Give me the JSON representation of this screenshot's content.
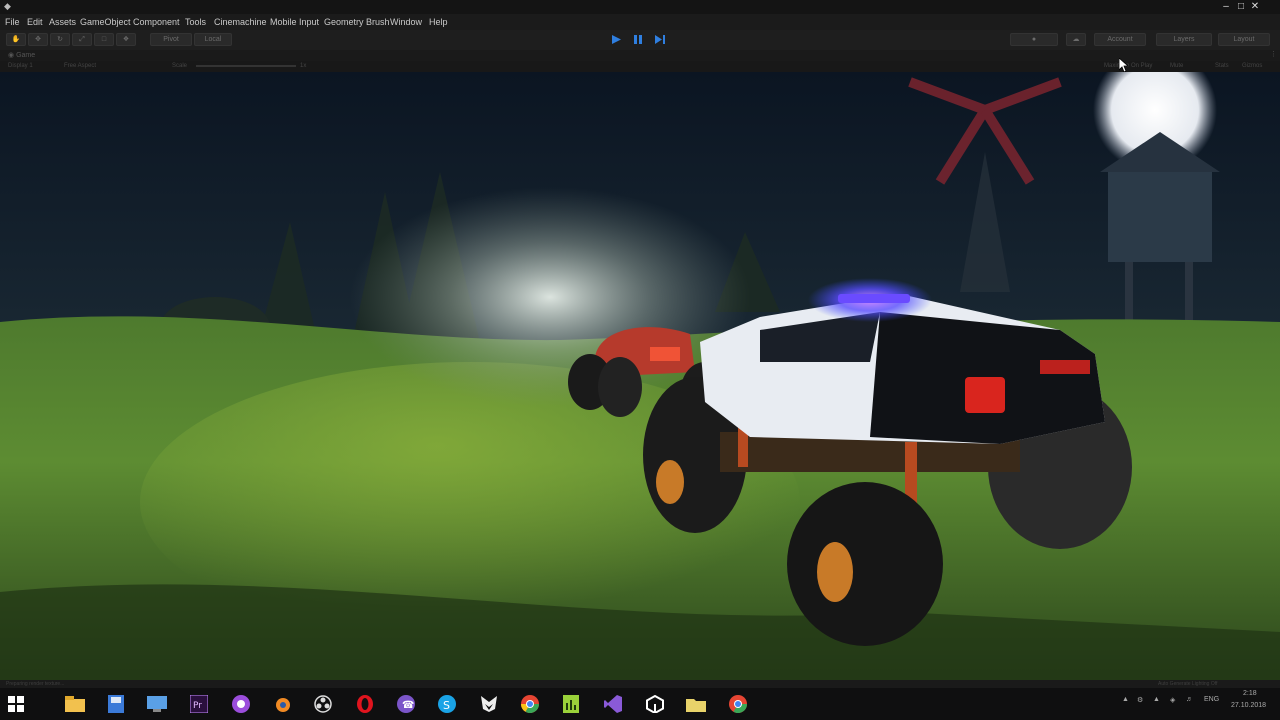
{
  "window": {
    "minimize": "–",
    "maximize": "□",
    "close": "✕"
  },
  "menu": {
    "items": [
      "File",
      "Edit",
      "Assets",
      "GameObject",
      "Component",
      "Tools",
      "Cinemachine",
      "Mobile Input",
      "Geometry Brush",
      "Window",
      "Help"
    ]
  },
  "toolbar": {
    "pivot_label": "Pivot",
    "local_label": "Local",
    "account_label": "Account",
    "layers_label": "Layers",
    "layout_label": "Layout"
  },
  "game_view": {
    "tab_label": "Game",
    "display_label": "Display 1",
    "aspect_label": "Free Aspect",
    "scale_label": "Scale",
    "scale_value": "1x",
    "maximize_on_play": "Maximize On Play",
    "mute_label": "Mute",
    "stats_label": "Stats",
    "gizmos_label": "Gizmos"
  },
  "status": {
    "left_message": "Preparing render texture...",
    "right_message": "Auto Generate Lighting Off"
  },
  "taskbar": {
    "apps": [
      "windows-start-icon",
      "file-explorer-icon",
      "save-disk-icon",
      "control-panel-icon",
      "premiere-icon",
      "recorder-icon",
      "blender-icon",
      "obs-icon",
      "opera-icon",
      "viber-icon",
      "skype-icon",
      "fox-app-icon",
      "chrome-icon",
      "spreadsheet-icon",
      "visual-studio-icon",
      "unity-icon",
      "folder-icon",
      "chrome-alt-icon"
    ],
    "language": "ENG",
    "time": "2:18",
    "date": "27.10.2018"
  },
  "colors": {
    "accent_play": "#2f7fe0",
    "grass": "#4f7a2a",
    "siren_blue": "#3b4dff",
    "siren_purple": "#b040ff"
  }
}
